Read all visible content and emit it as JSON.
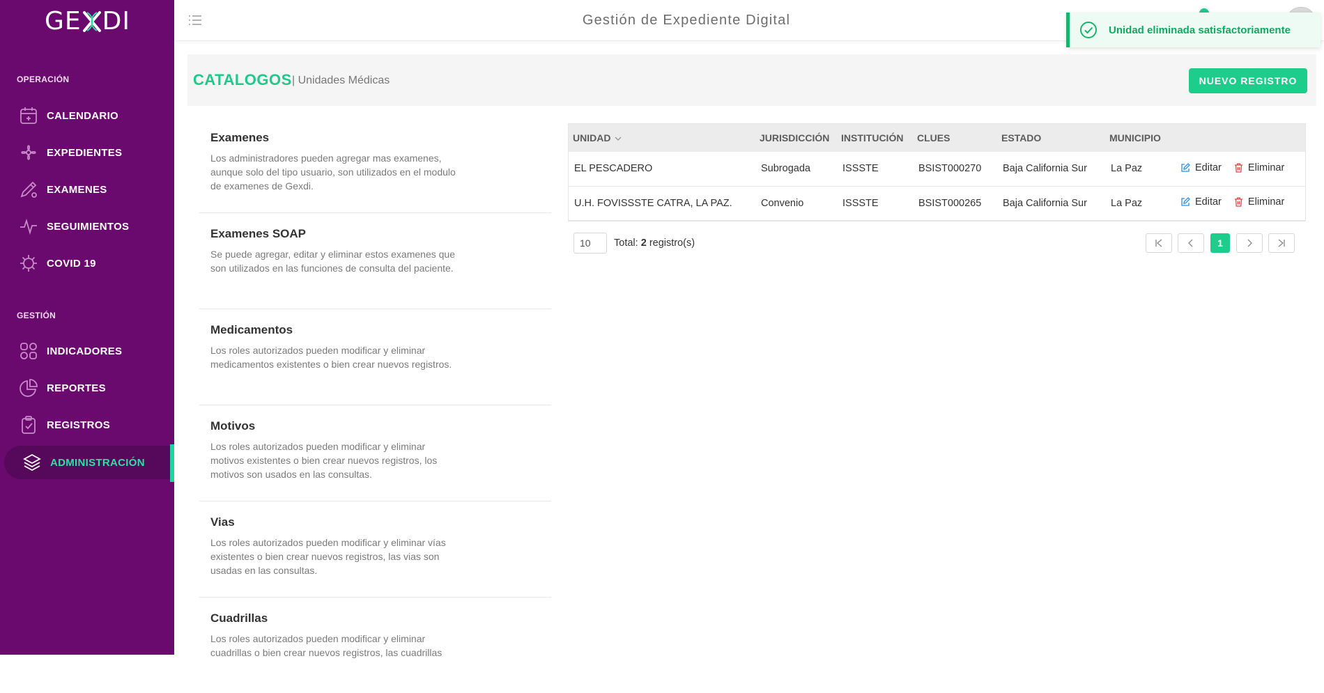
{
  "sidebar": {
    "logo": {
      "left": "GE",
      "right": "DI"
    },
    "sections": [
      {
        "label": "OPERACIÓN"
      },
      {
        "label": "GESTIÓN"
      }
    ],
    "items": [
      {
        "label": "CALENDARIO",
        "icon": "calendar-icon"
      },
      {
        "label": "EXPEDIENTES",
        "icon": "flower-icon"
      },
      {
        "label": "EXAMENES",
        "icon": "pencil-ruler-icon"
      },
      {
        "label": "SEGUIMIENTOS",
        "icon": "pulse-icon"
      },
      {
        "label": "COVID 19",
        "icon": "virus-icon"
      },
      {
        "label": "INDICADORES",
        "icon": "grid-icon"
      },
      {
        "label": "REPORTES",
        "icon": "pie-chart-icon"
      },
      {
        "label": "REGISTROS",
        "icon": "clipboard-icon"
      },
      {
        "label": "ADMINISTRACIÓN",
        "icon": "layers-icon",
        "active": true
      }
    ]
  },
  "header": {
    "title": "Gestión de Expediente Digital",
    "menu_icon": "list-menu-icon"
  },
  "toast": {
    "message": "Unidad eliminada satisfactoriamente",
    "icon": "check-circle-icon"
  },
  "page": {
    "title": "CATALOGOS",
    "subtitle": "| Unidades Médicas",
    "new_button": "NUEVO REGISTRO"
  },
  "catalogs": [
    {
      "name": "Examenes",
      "description": "Los administradores pueden agregar mas examenes, aunque solo del tipo usuario, son utilizados en el modulo de examenes de Gexdi."
    },
    {
      "name": "Examenes SOAP",
      "description": "Se puede agregar, editar y eliminar estos examenes que son utilizados en las funciones de consulta del paciente."
    },
    {
      "name": "Medicamentos",
      "description": "Los roles autorizados pueden modificar y eliminar medicamentos existentes o bien crear nuevos registros."
    },
    {
      "name": "Motivos",
      "description": "Los roles autorizados pueden modificar y eliminar motivos existentes o bien crear nuevos registros, los motivos son usados en las consultas."
    },
    {
      "name": "Vias",
      "description": "Los roles autorizados pueden modificar y eliminar vías existentes o bien crear nuevos registros, las vias son usadas en las consultas."
    },
    {
      "name": "Cuadrillas",
      "description": "Los roles autorizados pueden modificar y eliminar cuadrillas o bien crear nuevos registros, las cuadrillas"
    }
  ],
  "table": {
    "columns": [
      "UNIDAD",
      "JURISDICCIÓN",
      "INSTITUCIÓN",
      "CLUES",
      "ESTADO",
      "MUNICIPIO"
    ],
    "edit_label": "Editar",
    "delete_label": "Eliminar",
    "rows": [
      [
        "EL PESCADERO",
        "Subrogada",
        "ISSSTE",
        "BSIST000270",
        "Baja California Sur",
        "La Paz"
      ],
      [
        "U.H. FOVISSSTE CATRA, LA PAZ.",
        "Convenio",
        "ISSSTE",
        "BSIST000265",
        "Baja California Sur",
        "La Paz"
      ]
    ]
  },
  "pager": {
    "page_size": "10",
    "total_label": "Total:",
    "total_count": "2",
    "total_suffix": "registro(s)",
    "current_page": "1"
  },
  "colors": {
    "sidebar": "#6b0a6e",
    "accent": "#1ccd8b"
  }
}
